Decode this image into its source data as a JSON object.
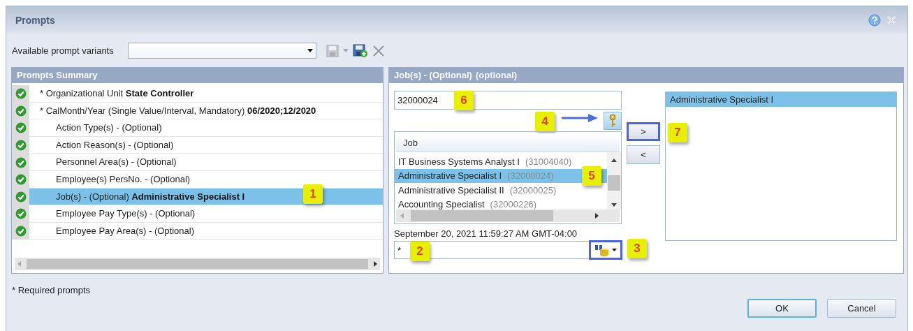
{
  "window": {
    "title": "Prompts"
  },
  "variants": {
    "label": "Available prompt variants"
  },
  "summary": {
    "title": "Prompts Summary",
    "rows": [
      {
        "kind": "mandatory",
        "label": "* Organizational Unit",
        "value": "State Controller",
        "complete": true,
        "selected": false
      },
      {
        "kind": "mandatory",
        "label": "* CalMonth/Year (Single Value/Interval, Mandatory)",
        "value": "06/2020;12/2020",
        "complete": true,
        "selected": false
      },
      {
        "kind": "optional",
        "label": "Action Type(s) - (Optional)",
        "complete": true,
        "selected": false
      },
      {
        "kind": "optional",
        "label": "Action Reason(s) - (Optional)",
        "complete": true,
        "selected": false
      },
      {
        "kind": "optional",
        "label": "Personnel Area(s) - (Optional)",
        "complete": true,
        "selected": false
      },
      {
        "kind": "optional",
        "label": "Employee(s) PersNo. - (Optional)",
        "complete": true,
        "selected": false
      },
      {
        "kind": "optional",
        "label": "Job(s) - (Optional)",
        "value": "Administrative Specialist I",
        "complete": true,
        "selected": true,
        "callout": "1"
      },
      {
        "kind": "optional",
        "label": "Employee Pay Type(s) - (Optional)",
        "complete": true,
        "selected": false
      },
      {
        "kind": "optional",
        "label": "Employee Pay Area(s) - (Optional)",
        "complete": true,
        "selected": false
      }
    ]
  },
  "job_panel": {
    "title": "Job(s) - (Optional)",
    "hint": "(optional)",
    "value_field": {
      "value": "32000024",
      "callout": "6"
    },
    "key_button": {
      "callout": "4"
    },
    "list": {
      "column": "Job",
      "rows": [
        {
          "name": "IT Business Systems Analyst I",
          "code": "(31004040)",
          "selected": false
        },
        {
          "name": "Administrative Specialist I",
          "code": "(32000024)",
          "selected": true,
          "callout": "5"
        },
        {
          "name": "Administrative Specialist II",
          "code": "(32000025)",
          "selected": false
        },
        {
          "name": "Accounting Specialist",
          "code": "(32000226)",
          "selected": false
        }
      ]
    },
    "timestamp": "September 20, 2021 11:59:27 AM GMT-04:00",
    "search_field": {
      "value": "*",
      "callout": "2"
    },
    "search_button": {
      "highlighted": true,
      "callout": "3"
    },
    "add_button": {
      "label": ">",
      "highlighted": true,
      "callout": "7"
    },
    "remove_button": {
      "label": "<",
      "highlighted": false
    },
    "selected_values": [
      {
        "label": "Administrative Specialist I",
        "selected": true
      }
    ]
  },
  "footer_note": "* Required prompts",
  "buttons": [
    {
      "label": "OK",
      "default": true
    },
    {
      "label": "Cancel",
      "default": false
    }
  ]
}
